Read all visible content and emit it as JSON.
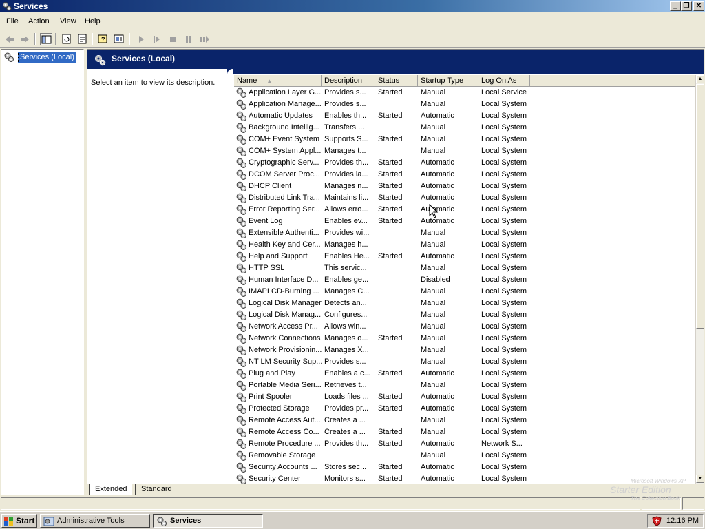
{
  "window": {
    "title": "Services",
    "buttons": {
      "minimize": "_",
      "restore": "❐",
      "close": "✕"
    }
  },
  "menu": [
    "File",
    "Action",
    "View",
    "Help"
  ],
  "toolbar": {
    "icons": [
      "back-arrow-icon",
      "forward-arrow-icon",
      "show-hide-tree-icon",
      "refresh-icon",
      "export-list-icon",
      "help-icon",
      "properties-icon",
      "start-service-icon",
      "resume-service-icon",
      "stop-service-icon",
      "pause-service-icon",
      "restart-service-icon"
    ]
  },
  "tree": {
    "root_label": "Services (Local)"
  },
  "pane": {
    "title": "Services (Local)",
    "description": "Select an item to view its description."
  },
  "columns": [
    "Name",
    "Description",
    "Status",
    "Startup Type",
    "Log On As"
  ],
  "services": [
    [
      "Application Layer G...",
      "Provides s...",
      "Started",
      "Manual",
      "Local Service"
    ],
    [
      "Application Manage...",
      "Provides s...",
      "",
      "Manual",
      "Local System"
    ],
    [
      "Automatic Updates",
      "Enables th...",
      "Started",
      "Automatic",
      "Local System"
    ],
    [
      "Background Intellig...",
      "Transfers ...",
      "",
      "Manual",
      "Local System"
    ],
    [
      "COM+ Event System",
      "Supports S...",
      "Started",
      "Manual",
      "Local System"
    ],
    [
      "COM+ System Appl...",
      "Manages t...",
      "",
      "Manual",
      "Local System"
    ],
    [
      "Cryptographic Serv...",
      "Provides th...",
      "Started",
      "Automatic",
      "Local System"
    ],
    [
      "DCOM Server Proc...",
      "Provides la...",
      "Started",
      "Automatic",
      "Local System"
    ],
    [
      "DHCP Client",
      "Manages n...",
      "Started",
      "Automatic",
      "Local System"
    ],
    [
      "Distributed Link Tra...",
      "Maintains li...",
      "Started",
      "Automatic",
      "Local System"
    ],
    [
      "Error Reporting Ser...",
      "Allows erro...",
      "Started",
      "Automatic",
      "Local System"
    ],
    [
      "Event Log",
      "Enables ev...",
      "Started",
      "Automatic",
      "Local System"
    ],
    [
      "Extensible Authenti...",
      "Provides wi...",
      "",
      "Manual",
      "Local System"
    ],
    [
      "Health Key and Cer...",
      "Manages h...",
      "",
      "Manual",
      "Local System"
    ],
    [
      "Help and Support",
      "Enables He...",
      "Started",
      "Automatic",
      "Local System"
    ],
    [
      "HTTP SSL",
      "This servic...",
      "",
      "Manual",
      "Local System"
    ],
    [
      "Human Interface D...",
      "Enables ge...",
      "",
      "Disabled",
      "Local System"
    ],
    [
      "IMAPI CD-Burning ...",
      "Manages C...",
      "",
      "Manual",
      "Local System"
    ],
    [
      "Logical Disk Manager",
      "Detects an...",
      "",
      "Manual",
      "Local System"
    ],
    [
      "Logical Disk Manag...",
      "Configures...",
      "",
      "Manual",
      "Local System"
    ],
    [
      "Network Access Pr...",
      "Allows win...",
      "",
      "Manual",
      "Local System"
    ],
    [
      "Network Connections",
      "Manages o...",
      "Started",
      "Manual",
      "Local System"
    ],
    [
      "Network Provisionin...",
      "Manages X...",
      "",
      "Manual",
      "Local System"
    ],
    [
      "NT LM Security Sup...",
      "Provides s...",
      "",
      "Manual",
      "Local System"
    ],
    [
      "Plug and Play",
      "Enables a c...",
      "Started",
      "Automatic",
      "Local System"
    ],
    [
      "Portable Media Seri...",
      "Retrieves t...",
      "",
      "Manual",
      "Local System"
    ],
    [
      "Print Spooler",
      "Loads files ...",
      "Started",
      "Automatic",
      "Local System"
    ],
    [
      "Protected Storage",
      "Provides pr...",
      "Started",
      "Automatic",
      "Local System"
    ],
    [
      "Remote Access Aut...",
      "Creates a ...",
      "",
      "Manual",
      "Local System"
    ],
    [
      "Remote Access Co...",
      "Creates a ...",
      "Started",
      "Manual",
      "Local System"
    ],
    [
      "Remote Procedure ...",
      "Provides th...",
      "Started",
      "Automatic",
      "Network S..."
    ],
    [
      "Removable Storage",
      "",
      "",
      "Manual",
      "Local System"
    ],
    [
      "Security Accounts ...",
      "Stores sec...",
      "Started",
      "Automatic",
      "Local System"
    ],
    [
      "Security Center",
      "Monitors s...",
      "Started",
      "Automatic",
      "Local System"
    ]
  ],
  "tabs": [
    "Extended",
    "Standard"
  ],
  "taskbar": {
    "start": "Start",
    "items": [
      "Administrative Tools",
      "Services"
    ],
    "clock": "12:16 PM"
  },
  "watermark": {
    "line1": "Microsoft Windows XP",
    "line2": "Starter Edition",
    "line3": "The Collection Book"
  },
  "colors": {
    "title_blue": "#0a246a",
    "selection": "#316ac5",
    "face": "#ece9d8"
  }
}
